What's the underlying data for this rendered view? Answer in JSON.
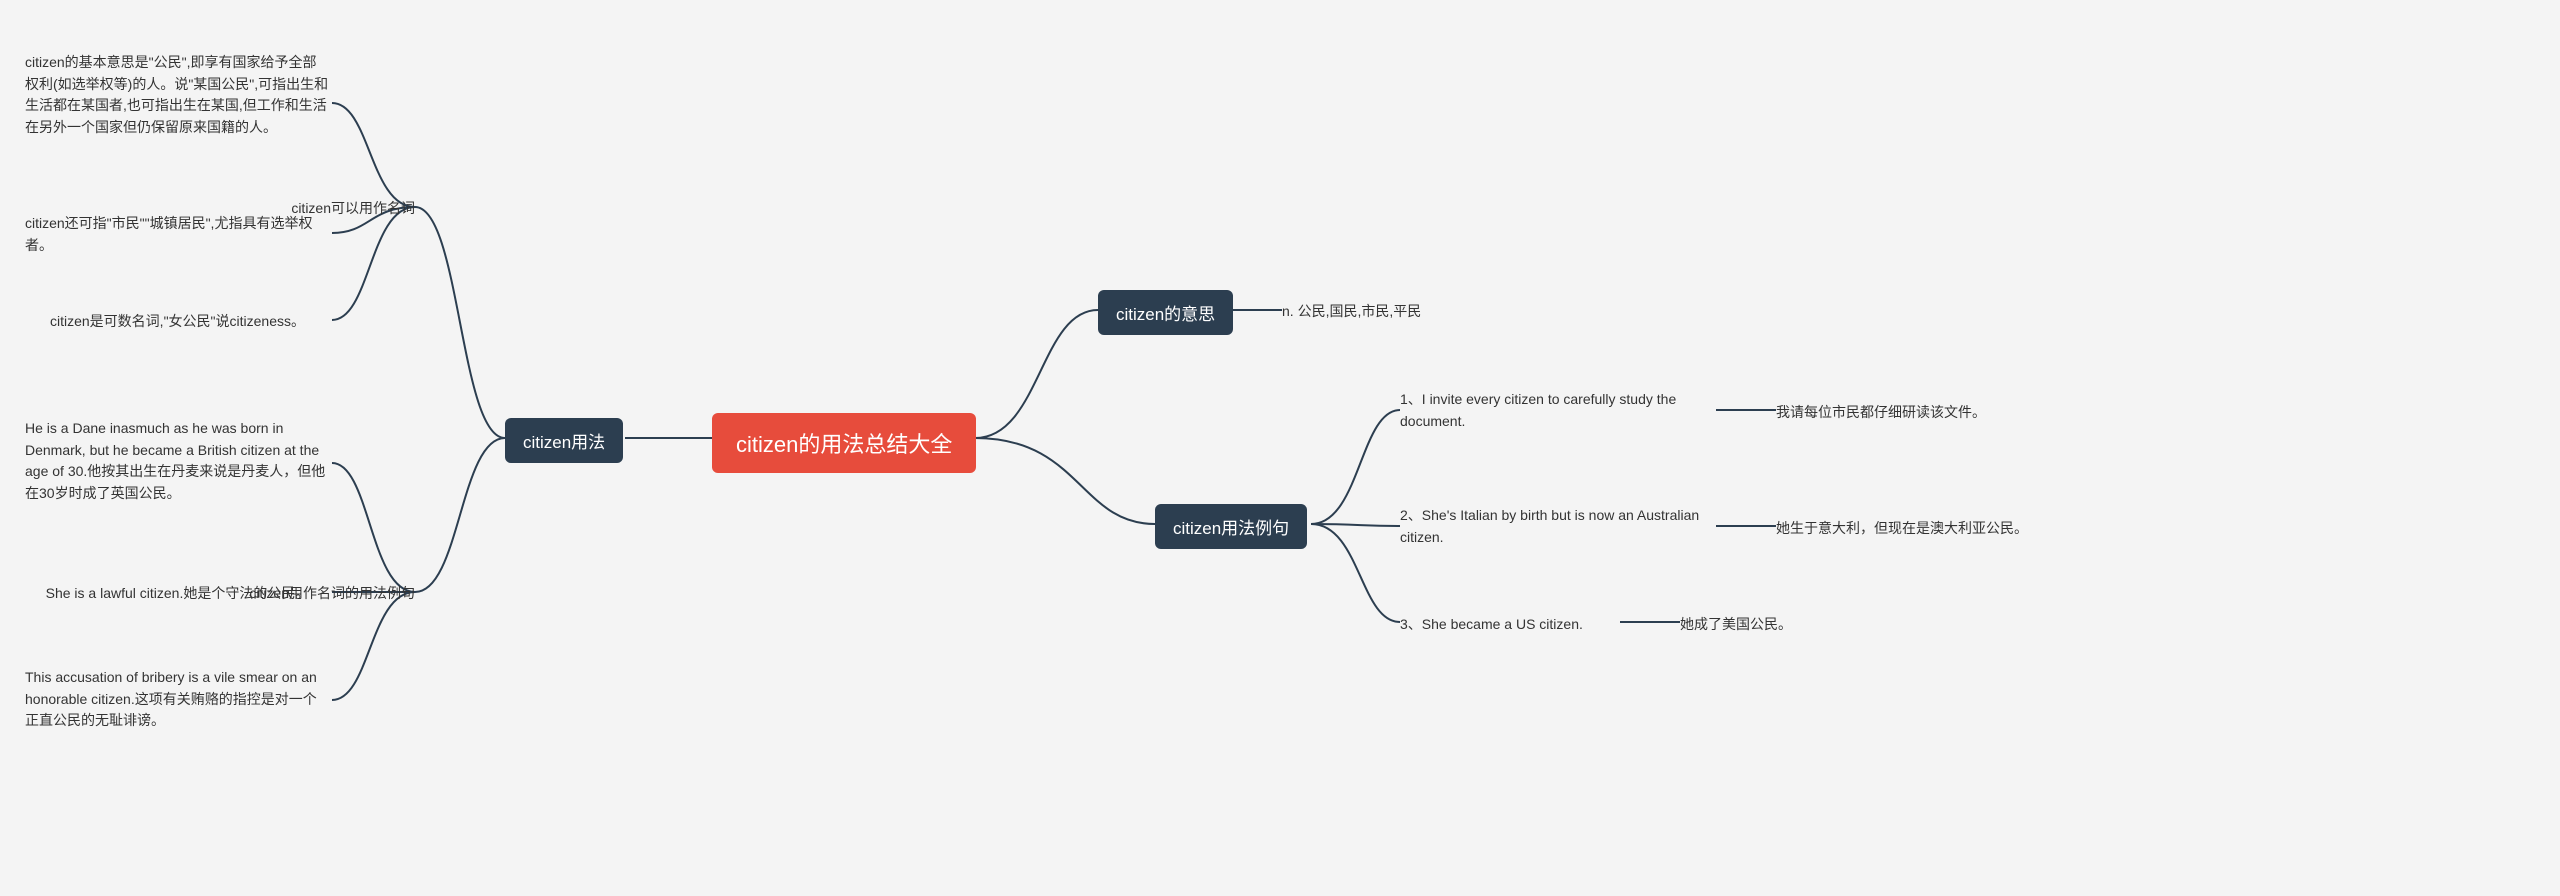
{
  "root": "citizen的用法总结大全",
  "meaning": {
    "label": "citizen的意思",
    "def": "n. 公民,国民,市民,平民"
  },
  "examples": {
    "label": "citizen用法例句",
    "e1": "1、I invite every citizen to carefully study the document.",
    "t1": "我请每位市民都仔细研读该文件。",
    "e2": "2、She's Italian by birth but is now an Australian citizen.",
    "t2": "她生于意大利，但现在是澳大利亚公民。",
    "e3": "3、She became a US citizen.",
    "t3": "她成了美国公民。"
  },
  "usage": {
    "label": "citizen用法",
    "noun": {
      "label": "citizen可以用作名词",
      "n1": "citizen的基本意思是\"公民\",即享有国家给予全部权利(如选举权等)的人。说\"某国公民\",可指出生和生活都在某国者,也可指出生在某国,但工作和生活在另外一个国家但仍保留原来国籍的人。",
      "n2": "citizen还可指\"市民\"\"城镇居民\",尤指具有选举权者。",
      "n3": "citizen是可数名词,\"女公民\"说citizeness。"
    },
    "nounex": {
      "label": "citizen用作名词的用法例句",
      "x1": "He is a Dane inasmuch as he was born in Denmark, but he became a British citizen at the age of 30.他按其出生在丹麦来说是丹麦人，但他在30岁时成了英国公民。",
      "x2": "She is a lawful citizen.她是个守法的公民。",
      "x3": "This accusation of bribery is a vile smear on an honorable citizen.这项有关贿赂的指控是对一个正直公民的无耻诽谤。"
    }
  }
}
